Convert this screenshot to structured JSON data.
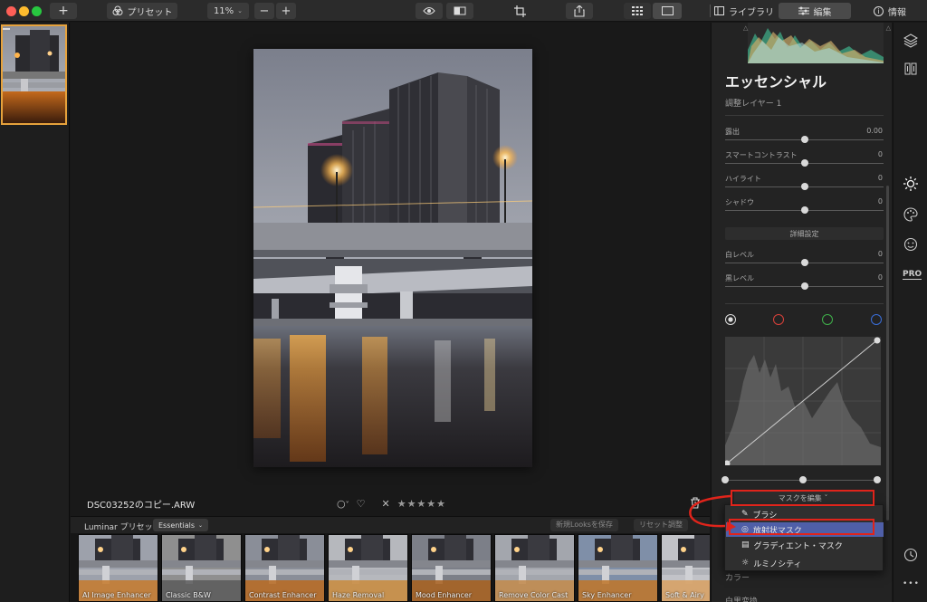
{
  "toolbar": {
    "presets_label": "プリセット",
    "zoom": "11%",
    "zoom_out": "−",
    "zoom_in": "+",
    "add": "+",
    "tabs": {
      "library": "ライブラリ",
      "edit": "編集",
      "info": "情報"
    }
  },
  "canvas": {
    "filename": "DSC03252のコピー.ARW",
    "rating_stars": "★★★★★",
    "reject": "✕",
    "heart": "♡",
    "flag": "○",
    "flag_caret": "˅"
  },
  "presets": {
    "title": "Luminar プリセット",
    "category": "Essentials",
    "save_look_label": "新規Looksを保存",
    "reset_label": "リセット調整",
    "items": [
      {
        "label": "AI Image Enhancer"
      },
      {
        "label": "Classic B&W"
      },
      {
        "label": "Contrast Enhancer"
      },
      {
        "label": "Haze Removal"
      },
      {
        "label": "Mood Enhancer"
      },
      {
        "label": "Remove Color Cast"
      },
      {
        "label": "Sky Enhancer"
      },
      {
        "label": "Soft & Airy"
      }
    ]
  },
  "panel": {
    "section_title": "エッセンシャル",
    "layer_label": "調整レイヤー 1",
    "sliders": [
      {
        "label": "露出",
        "value": "0.00",
        "pos": 0.5
      },
      {
        "label": "スマートコントラスト",
        "value": "0",
        "pos": 0.5
      },
      {
        "label": "ハイライト",
        "value": "0",
        "pos": 0.5
      },
      {
        "label": "シャドウ",
        "value": "0",
        "pos": 0.5
      }
    ],
    "advanced_label": "詳細設定",
    "sliders2": [
      {
        "label": "白レベル",
        "value": "0",
        "pos": 0.5
      },
      {
        "label": "黒レベル",
        "value": "0",
        "pos": 0.5
      }
    ],
    "mask_edit_label": "マスクを編集",
    "mask_caret": "˅",
    "next_section": "カラー",
    "next_section2": "白黒変換"
  },
  "mask_menu": {
    "items": [
      {
        "label": "ブラシ",
        "icon": "brush-icon"
      },
      {
        "label": "放射状マスク",
        "icon": "radial-mask-icon"
      },
      {
        "label": "グラディエント・マスク",
        "icon": "gradient-mask-icon"
      },
      {
        "label": "ルミノシティ",
        "icon": "luminosity-icon"
      }
    ],
    "selected_index": 1
  },
  "tool_rail": {
    "pro_label": "PRO",
    "more": "•••"
  },
  "colors": {
    "accent_orange": "#e6a23c",
    "highlight_red": "#e0241b",
    "menu_selected": "#4f5fa8",
    "curve_red": "#d9413a",
    "curve_green": "#3fb04a",
    "curve_blue": "#3a6ed9"
  }
}
